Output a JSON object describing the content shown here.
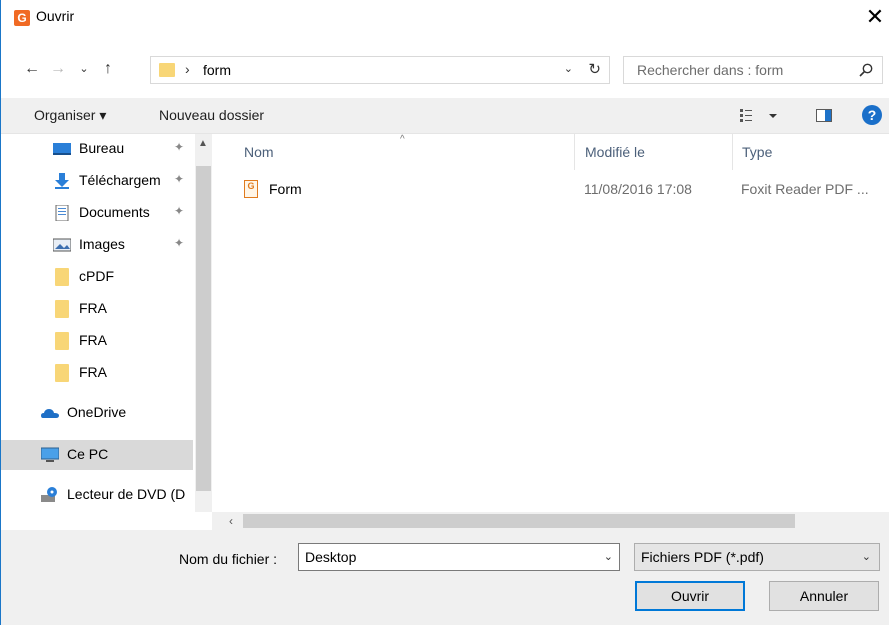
{
  "dialog": {
    "title": "Ouvrir",
    "app_icon_letter": "G",
    "close": "✕"
  },
  "navigation": {
    "back": "←",
    "forward": "→",
    "recent": "⌄",
    "up": "↑",
    "path_separator": "›",
    "path": "form",
    "dropdown": "⌄",
    "refresh": "↻",
    "search_placeholder": "Rechercher dans : form"
  },
  "toolbar": {
    "organise": "Organiser ▾",
    "new_folder": "Nouveau dossier",
    "view_icon": "view-options-icon",
    "pane_icon": "preview-pane-icon",
    "help": "?"
  },
  "sidebar": {
    "items": [
      {
        "label": "Bureau",
        "icon": "desktop-icon",
        "pinned": true
      },
      {
        "label": "Téléchargem",
        "icon": "download-icon",
        "pinned": true
      },
      {
        "label": "Documents",
        "icon": "documents-icon",
        "pinned": true
      },
      {
        "label": "Images",
        "icon": "images-icon",
        "pinned": true
      },
      {
        "label": "cPDF",
        "icon": "folder-icon",
        "pinned": false
      },
      {
        "label": "FRA",
        "icon": "folder-icon",
        "pinned": false
      },
      {
        "label": "FRA",
        "icon": "folder-icon",
        "pinned": false
      },
      {
        "label": "FRA",
        "icon": "folder-icon",
        "pinned": false
      },
      {
        "label": "OneDrive",
        "icon": "onedrive-icon",
        "pinned": false
      },
      {
        "label": "Ce PC",
        "icon": "computer-icon",
        "pinned": false,
        "selected": true
      },
      {
        "label": "Lecteur de DVD (D",
        "icon": "dvd-drive-icon",
        "pinned": false
      }
    ],
    "pin_glyph": "📌"
  },
  "filelist": {
    "columns": {
      "name": "Nom",
      "modified": "Modifié le",
      "type": "Type"
    },
    "sort_indicator": "^",
    "rows": [
      {
        "name": "Form",
        "modified": "11/08/2016 17:08",
        "type": "Foxit Reader PDF ...",
        "icon": "pdf-file-icon"
      }
    ]
  },
  "footer": {
    "filename_label": "Nom du fichier :",
    "filename_value": "Desktop",
    "filetype_value": "Fichiers PDF (*.pdf)",
    "open_button": "Ouvrir",
    "cancel_button": "Annuler"
  },
  "colors": {
    "accent": "#0078d7",
    "folder": "#f8d677",
    "help": "#1a6fc9",
    "app_icon": "#f06a24"
  }
}
